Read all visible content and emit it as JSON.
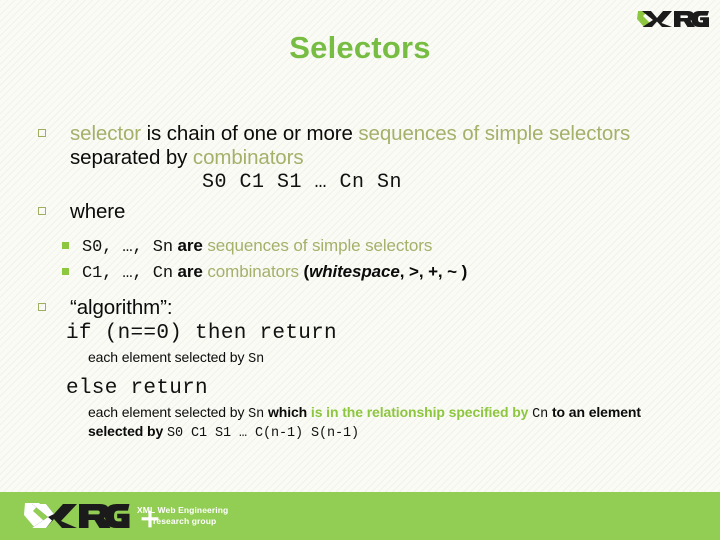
{
  "header": {
    "logo_alt": "XRG",
    "logo_text": "XRG"
  },
  "title": "Selectors",
  "colors": {
    "title_green": "#77bd43",
    "accent_olive": "#a5b06a",
    "bright_green": "#8dc63f",
    "footer_band": "#92cd54",
    "background": "#fbfbf6",
    "text_black": "#0b0b0b"
  },
  "bullets": {
    "level1_glyph": "hollow-square",
    "level2_glyph": "filled-square"
  },
  "content": {
    "b1": {
      "w1": "selector",
      "w2": " is chain of one or more ",
      "w3": "sequences of simple selectors",
      "w4": " separated by ",
      "w5": "combinators",
      "code": "S0 C1 S1 … Cn Sn"
    },
    "b2": {
      "label": "where",
      "sub1_code": "S0, …, Sn",
      "sub1_mid": " are ",
      "sub1_green": "sequences of simple selectors",
      "sub2_code": "C1, …, Cn",
      "sub2_mid": " are ",
      "sub2_green": "combinators",
      "sub2_paren_open": " (",
      "sub2_ital": "whitespace",
      "sub2_rest": ", >, +, ~ )"
    },
    "b3": {
      "label": "“algorithm”:",
      "if_line": "if (n==0) then return",
      "if_note_pre": "each element selected by ",
      "if_note_code": "Sn",
      "else_line": "else return",
      "else_note_pre": "each element selected by ",
      "else_note_code1": "Sn",
      "else_note_mid": " which ",
      "else_note_green": "is in the relationship specified by",
      "else_note_code2": "Cn",
      "else_note_mid2": " to an element selected by ",
      "else_note_code3": "S0 C1 S1 … C(n-1) S(n-1)"
    }
  },
  "footer": {
    "logo_text": "XRG",
    "tagline_line1": "XML   Web Engineering",
    "tagline_line2": "research group",
    "plus_symbol": "+"
  }
}
